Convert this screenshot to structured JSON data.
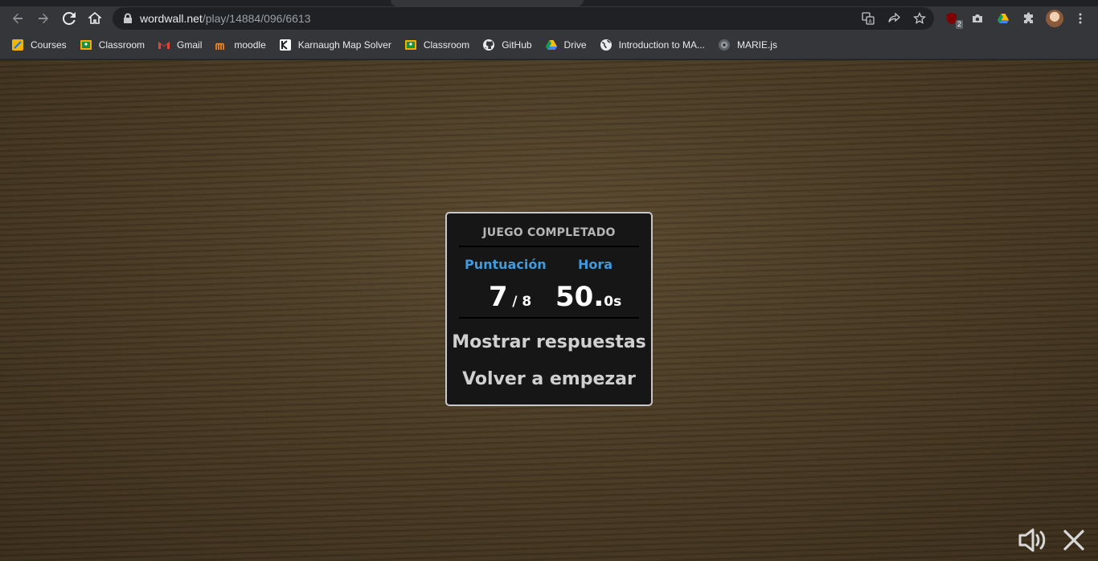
{
  "browser": {
    "url_host": "wordwall.net",
    "url_path": "/play/14884/096/6613",
    "extension_badge": "2",
    "icons": [
      "back-icon",
      "forward-icon",
      "reload-icon",
      "home-icon",
      "lock-icon",
      "translate-icon",
      "share-icon",
      "star-icon",
      "ublock-icon",
      "camera-icon",
      "drive-icon",
      "puzzle-icon",
      "avatar",
      "menu-icon"
    ]
  },
  "bookmarks": [
    {
      "label": "Courses",
      "icon": "courses-icon"
    },
    {
      "label": "Classroom",
      "icon": "classroom-icon"
    },
    {
      "label": "Gmail",
      "icon": "gmail-icon"
    },
    {
      "label": "moodle",
      "icon": "moodle-icon"
    },
    {
      "label": "Karnaugh Map Solver",
      "icon": "kmap-icon"
    },
    {
      "label": "Classroom",
      "icon": "classroom-icon"
    },
    {
      "label": "GitHub",
      "icon": "github-icon"
    },
    {
      "label": "Drive",
      "icon": "drive-icon"
    },
    {
      "label": "Introduction to MA...",
      "icon": "globe-icon"
    },
    {
      "label": "MARIE.js",
      "icon": "marie-icon"
    }
  ],
  "game": {
    "title": "JUEGO COMPLETADO",
    "score_label": "Puntuación",
    "time_label": "Hora",
    "score_value": "7",
    "score_total": "/ 8",
    "time_main": "50.",
    "time_fraction": "0s",
    "show_answers": "Mostrar respuestas",
    "restart": "Volver a empezar",
    "accent_color": "#3d9bdf"
  },
  "controls": {
    "sound_icon": "speaker-icon",
    "close_icon": "close-icon"
  }
}
